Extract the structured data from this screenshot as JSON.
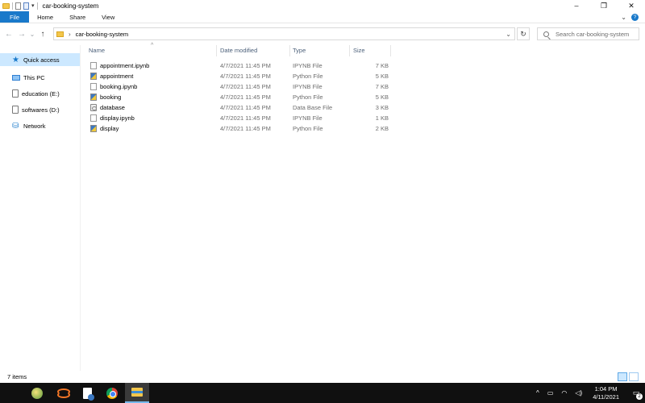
{
  "window": {
    "title": "car-booking-system",
    "controls": {
      "minimize": "–",
      "maximize": "❐",
      "close": "✕"
    }
  },
  "ribbon": {
    "tabs": [
      "File",
      "Home",
      "Share",
      "View"
    ],
    "expand_icon": "chevron-down-icon",
    "help_label": "?"
  },
  "address_bar": {
    "path": "car-booking-system",
    "back": "←",
    "forward": "→",
    "recent": "⌄",
    "up": "↑",
    "dropdown": "⌄",
    "refresh": "↻"
  },
  "search": {
    "placeholder": "Search car-booking-system"
  },
  "nav_pane": {
    "items": [
      {
        "label": "Quick access",
        "icon": "star-icon",
        "selected": true
      },
      {
        "label": "This PC",
        "icon": "computer-icon"
      },
      {
        "label": "education (E:)",
        "icon": "drive-icon"
      },
      {
        "label": "softwares (D:)",
        "icon": "drive-icon"
      },
      {
        "label": "Network",
        "icon": "network-icon"
      }
    ]
  },
  "file_list": {
    "columns": [
      "Name",
      "Date modified",
      "Type",
      "Size"
    ],
    "sort_indicator": "^",
    "rows": [
      {
        "name": "appointment.ipynb",
        "date": "4/7/2021 11:45 PM",
        "type": "IPYNB File",
        "size": "7 KB",
        "icon": "file-icon"
      },
      {
        "name": "appointment",
        "date": "4/7/2021 11:45 PM",
        "type": "Python File",
        "size": "5 KB",
        "icon": "python-file-icon"
      },
      {
        "name": "booking.ipynb",
        "date": "4/7/2021 11:45 PM",
        "type": "IPYNB File",
        "size": "7 KB",
        "icon": "file-icon"
      },
      {
        "name": "booking",
        "date": "4/7/2021 11:45 PM",
        "type": "Python File",
        "size": "5 KB",
        "icon": "python-file-icon"
      },
      {
        "name": "database",
        "date": "4/7/2021 11:45 PM",
        "type": "Data Base File",
        "size": "3 KB",
        "icon": "database-file-icon"
      },
      {
        "name": "display.ipynb",
        "date": "4/7/2021 11:45 PM",
        "type": "IPYNB File",
        "size": "1 KB",
        "icon": "file-icon"
      },
      {
        "name": "display",
        "date": "4/7/2021 11:45 PM",
        "type": "Python File",
        "size": "2 KB",
        "icon": "python-file-icon"
      }
    ]
  },
  "status_bar": {
    "item_count": "7 items"
  },
  "taskbar": {
    "apps": [
      "app-icon",
      "jupyter-icon",
      "document-icon",
      "chrome-icon",
      "file-explorer-icon"
    ],
    "tray": {
      "chevron": "^",
      "battery": "▭",
      "network": "◠",
      "volume": "◁)"
    },
    "time": "1:04 PM",
    "date": "4/11/2021",
    "notifications": "2"
  }
}
